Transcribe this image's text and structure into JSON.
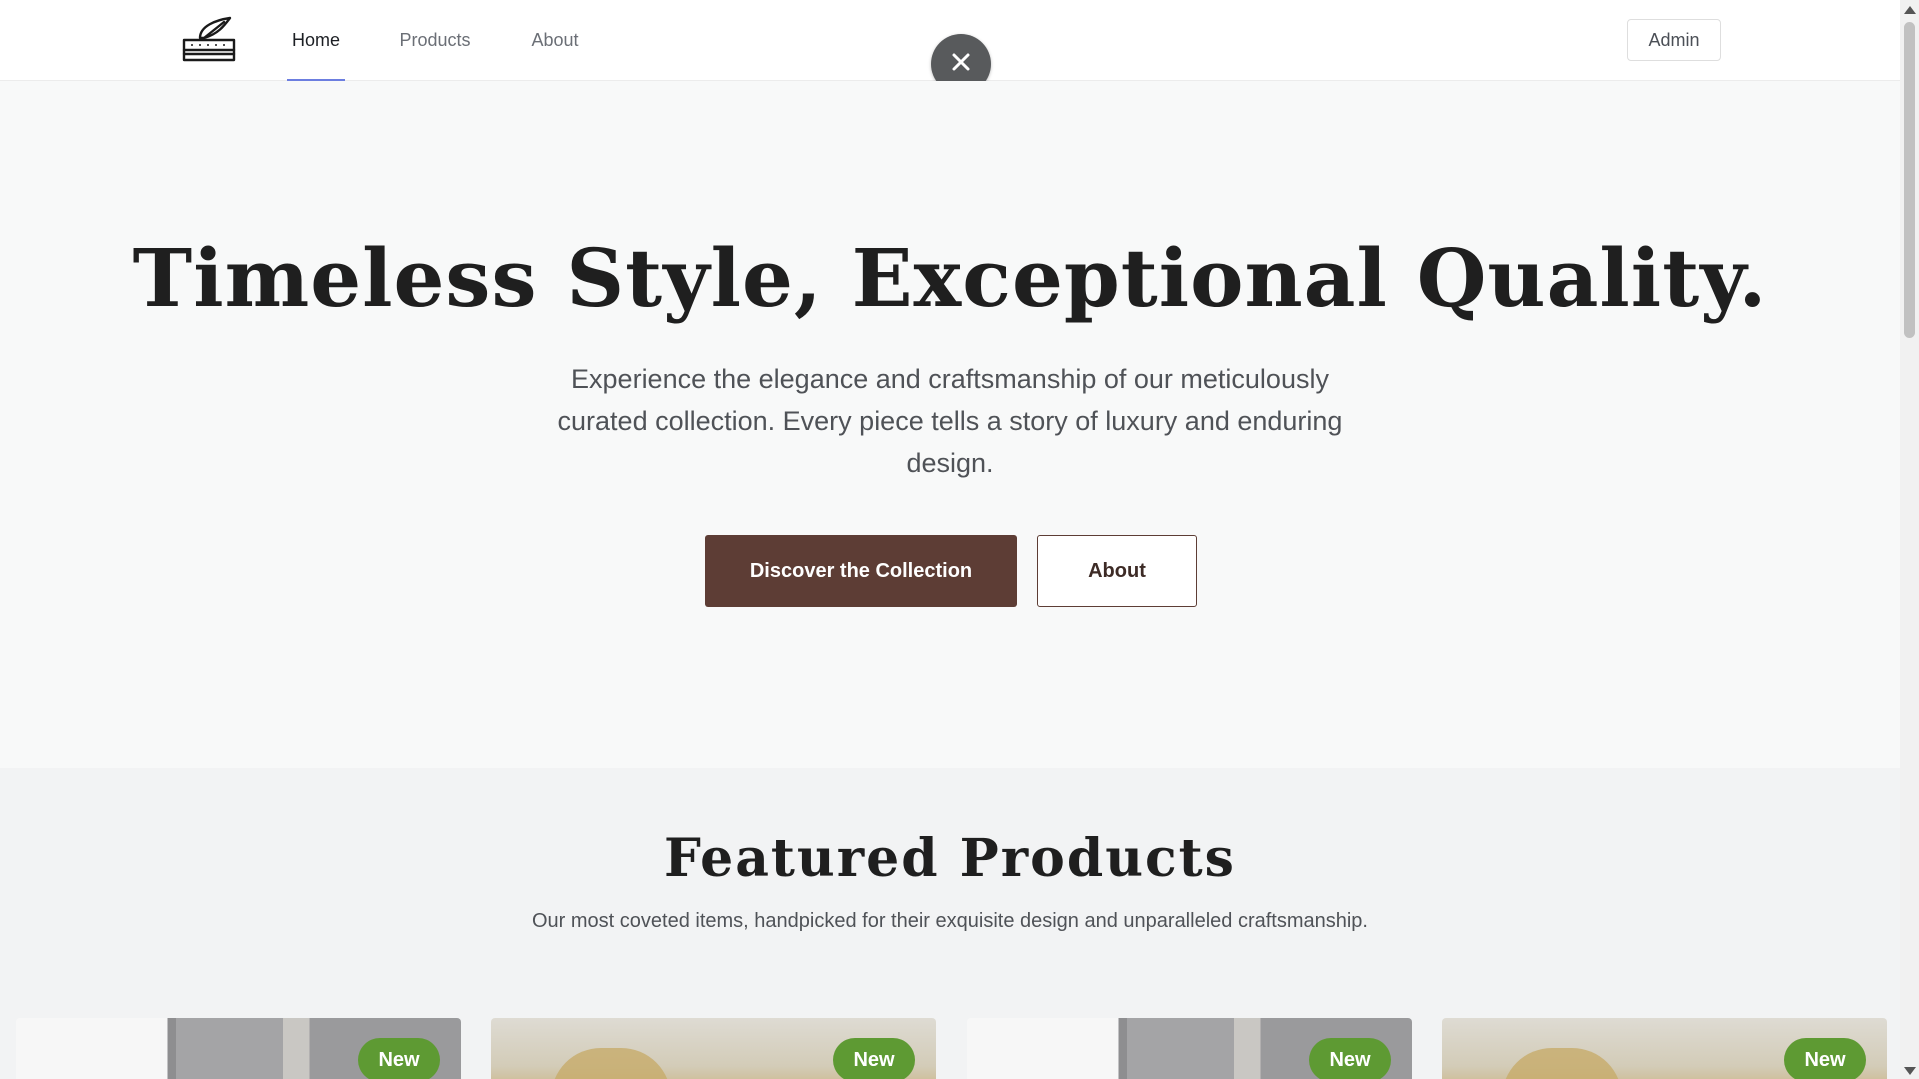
{
  "header": {
    "nav": [
      {
        "label": "Home",
        "active": true
      },
      {
        "label": "Products",
        "active": false
      },
      {
        "label": "About",
        "active": false
      }
    ],
    "admin_label": "Admin",
    "logo_icon": "mattress-feather-logo",
    "close_icon": "close-icon"
  },
  "hero": {
    "title": "Timeless Style, Exceptional Quality.",
    "subtitle": "Experience the elegance and craftsmanship of our meticulously curated collection. Every piece tells a story of luxury and enduring design.",
    "primary_button": "Discover the Collection",
    "secondary_button": "About"
  },
  "featured": {
    "title": "Featured Products",
    "subtitle": "Our most coveted items, handpicked for their exquisite design and unparalleled craftsmanship.",
    "products": [
      {
        "badge": "New"
      },
      {
        "badge": "New"
      },
      {
        "badge": "New"
      },
      {
        "badge": "New"
      }
    ]
  },
  "colors": {
    "primary_brown": "#5d3d35",
    "badge_green": "#5e9a33",
    "nav_active_underline": "#6c7ee0"
  }
}
